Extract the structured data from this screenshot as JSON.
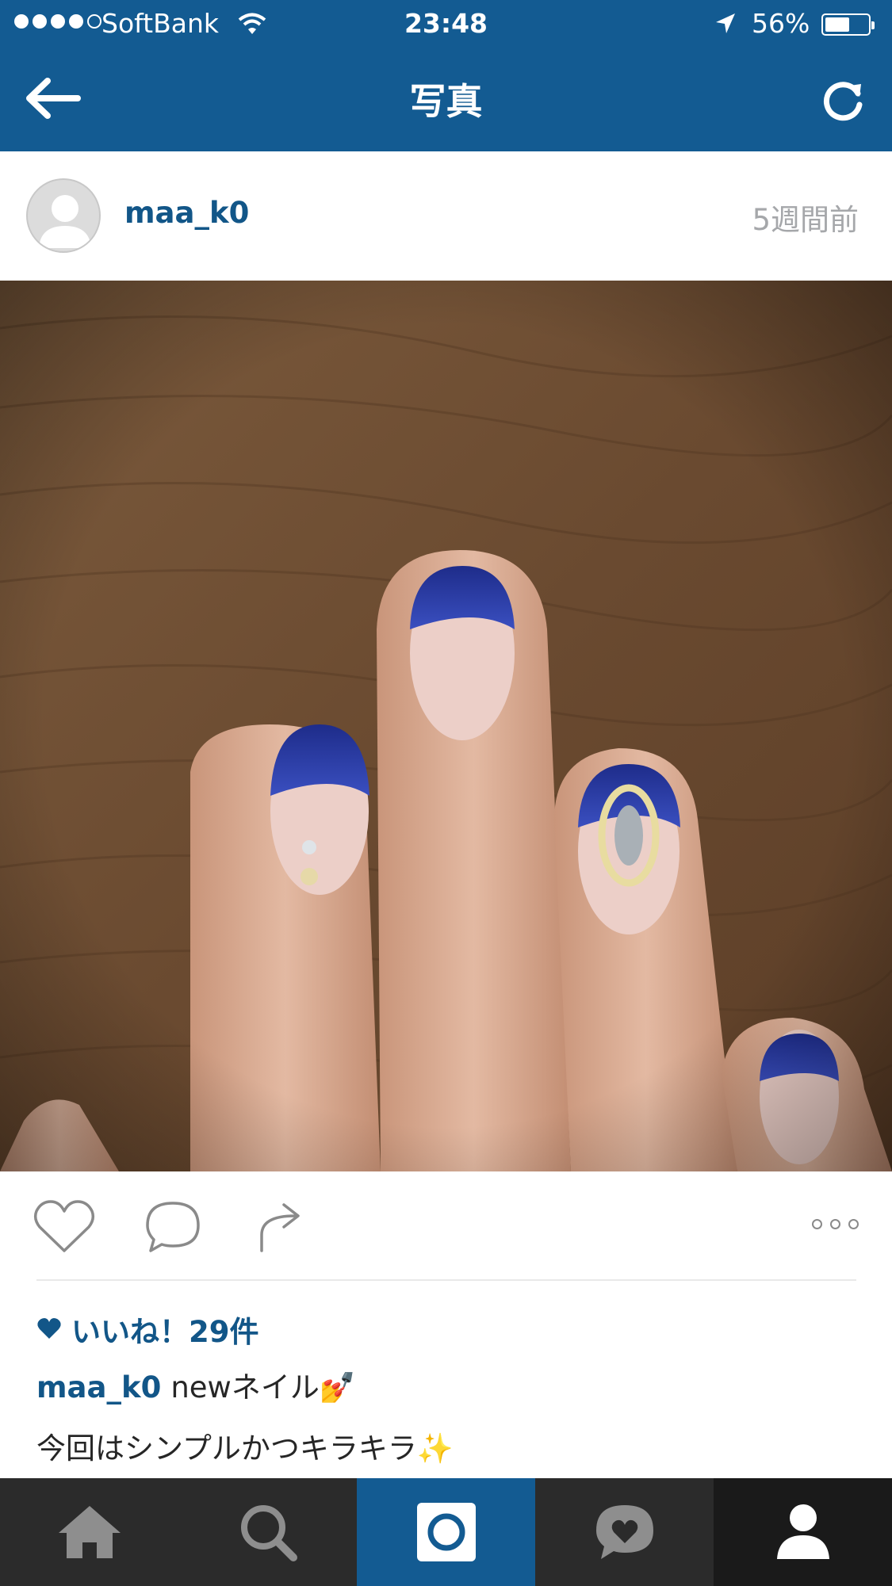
{
  "status_bar": {
    "carrier": "SoftBank",
    "time": "23:48",
    "battery_percent": "56%",
    "signal_icon": "signal-dots-icon",
    "wifi_icon": "wifi-icon",
    "location_icon": "location-arrow-icon",
    "battery_level": 0.56
  },
  "nav": {
    "title": "写真",
    "back_icon": "back-arrow-icon",
    "refresh_icon": "refresh-icon"
  },
  "post": {
    "username": "maa_k0",
    "time_ago": "5週間前",
    "avatar_icon": "default-avatar-icon",
    "photo": "nail-art-photo",
    "likes_text": "いいね！29件",
    "caption_user": "maa_k0",
    "caption_text": "newネイル💅",
    "caption_line2": "今回はシンプルかつキラキラ✨"
  },
  "actions": {
    "like_icon": "heart-icon",
    "comment_icon": "comment-bubble-icon",
    "share_icon": "share-arrow-icon",
    "more_icon": "more-dots-icon"
  },
  "tabbar": {
    "items": [
      "home-icon",
      "search-icon",
      "camera-icon",
      "activity-heart-icon",
      "profile-icon"
    ],
    "active": "camera-icon"
  },
  "colors": {
    "brand_blue": "#135b92",
    "link_blue": "#125688",
    "tabbar_dark": "#2b2b2b"
  }
}
